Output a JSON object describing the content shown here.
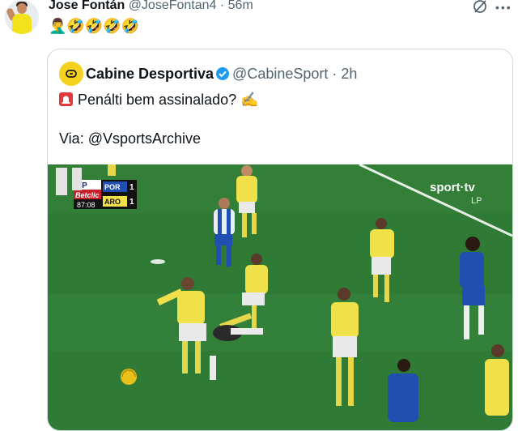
{
  "tweet": {
    "author_name": "Jose Fontán",
    "author_meta": "@JoseFontan4 · 56m",
    "text": "🤦‍♂️🤣🤣🤣🤣"
  },
  "quote": {
    "author_name": "Cabine Desportiva",
    "author_meta": "@CabineSport · 2h",
    "text_line1": "Penálti bem assinalado? ✍️",
    "text_line2": "Via: @VsportsArchive"
  },
  "media": {
    "scoreboard": {
      "league": "LP",
      "sponsor": "Betclic",
      "clock": "87:08",
      "home_team": "POR",
      "home_score": "1",
      "away_team": "ARO",
      "away_score": "1"
    },
    "broadcaster": "sport·tv",
    "broadcaster_sub": "LP"
  },
  "colors": {
    "pitch": "#2f7a34",
    "pitch_light": "#3a8b3e",
    "yellow_kit": "#f0e04a",
    "blue_kit": "#1f4fb0",
    "verified": "#1d9bf0",
    "text_secondary": "#536471"
  }
}
